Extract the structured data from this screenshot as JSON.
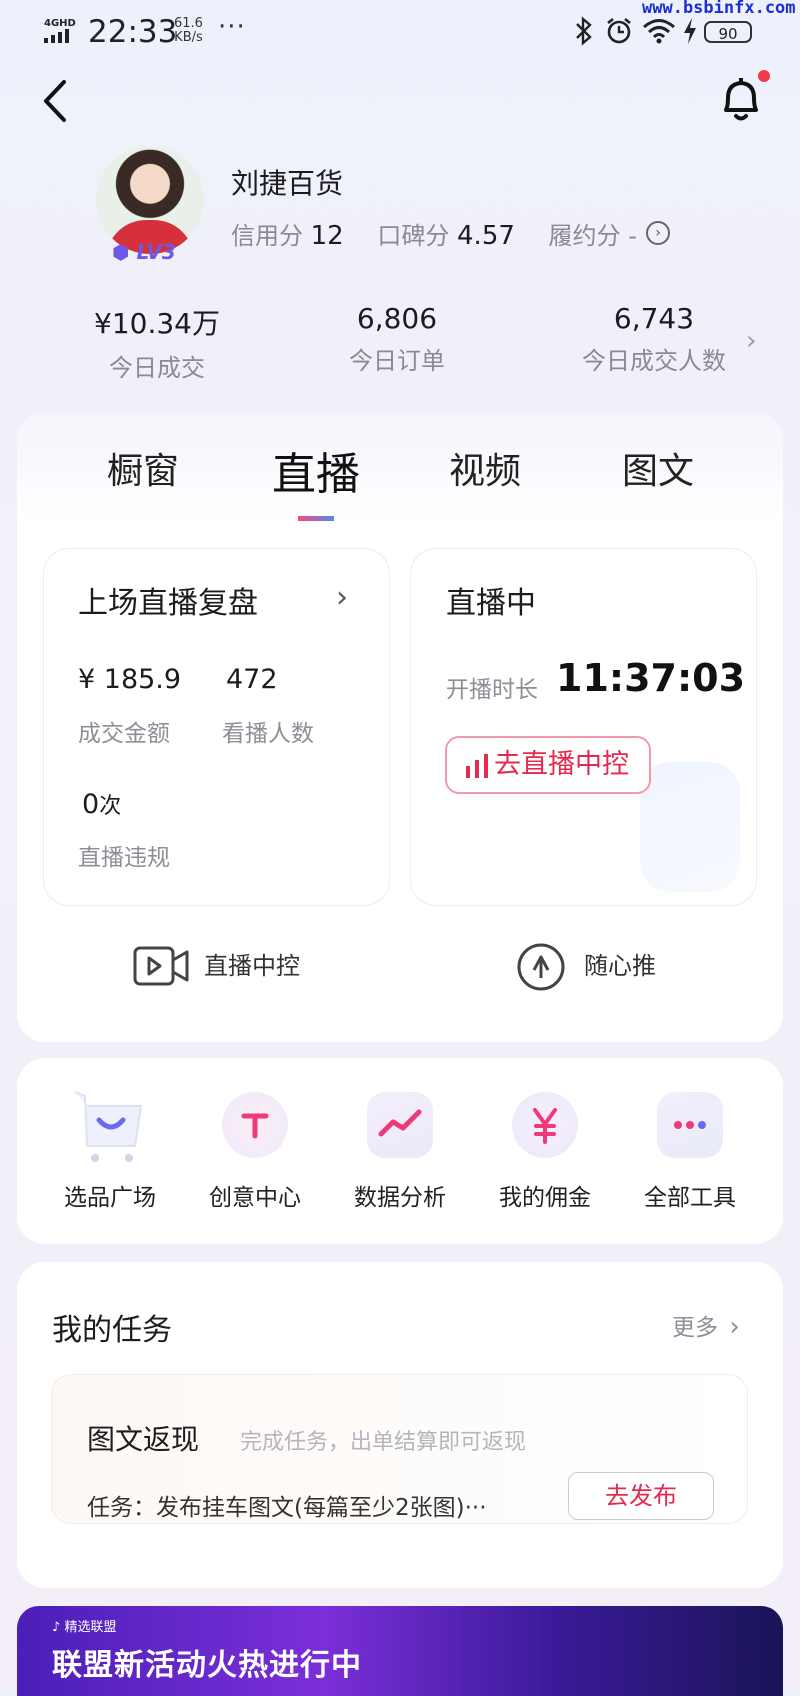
{
  "status_bar": {
    "network": "4GHD",
    "time": "22:33",
    "speed_value": "61.6",
    "speed_unit": "KB/s",
    "more": "···",
    "battery": "90",
    "watermark": "www.bsbinfx.com"
  },
  "profile": {
    "name": "刘捷百货",
    "level": "LV3",
    "credit_label": "信用分",
    "credit_value": "12",
    "reputation_label": "口碑分",
    "reputation_value": "4.57",
    "fulfil_label": "履约分",
    "fulfil_value": "-"
  },
  "stats": [
    {
      "value": "¥10.34万",
      "label": "今日成交"
    },
    {
      "value": "6,806",
      "label": "今日订单"
    },
    {
      "value": "6,743",
      "label": "今日成交人数"
    }
  ],
  "tabs": [
    "橱窗",
    "直播",
    "视频",
    "图文"
  ],
  "active_tab": "直播",
  "last_live": {
    "title": "上场直播复盘",
    "gmv_value": "¥ 185.9",
    "gmv_label": "成交金额",
    "viewers_value": "472",
    "viewers_label": "看播人数",
    "violations_value": "0",
    "violations_unit": "次",
    "violations_label": "直播违规"
  },
  "live_now": {
    "title": "直播中",
    "duration_label": "开播时长",
    "duration": "11:37:03",
    "button": "去直播中控"
  },
  "bottom_links": {
    "control": "直播中控",
    "promote": "随心推"
  },
  "tools": [
    {
      "label": "选品广场",
      "icon": "cart-icon"
    },
    {
      "label": "创意中心",
      "icon": "bulb-icon"
    },
    {
      "label": "数据分析",
      "icon": "chart-icon"
    },
    {
      "label": "我的佣金",
      "icon": "yuan-icon"
    },
    {
      "label": "全部工具",
      "icon": "more-dots-icon"
    }
  ],
  "tasks": {
    "title": "我的任务",
    "more": "更多",
    "item_title": "图文返现",
    "item_sub": "完成任务，出单结算即可返现",
    "item_desc": "任务：发布挂车图文(每篇至少2张图)···",
    "item_button": "去发布"
  },
  "banner": {
    "brand": "精选联盟",
    "text": "联盟新活动火热进行中"
  },
  "colors": {
    "accent_red": "#e52a4d",
    "level_purple": "#6d58e6",
    "notification_dot": "#f23a4b"
  }
}
